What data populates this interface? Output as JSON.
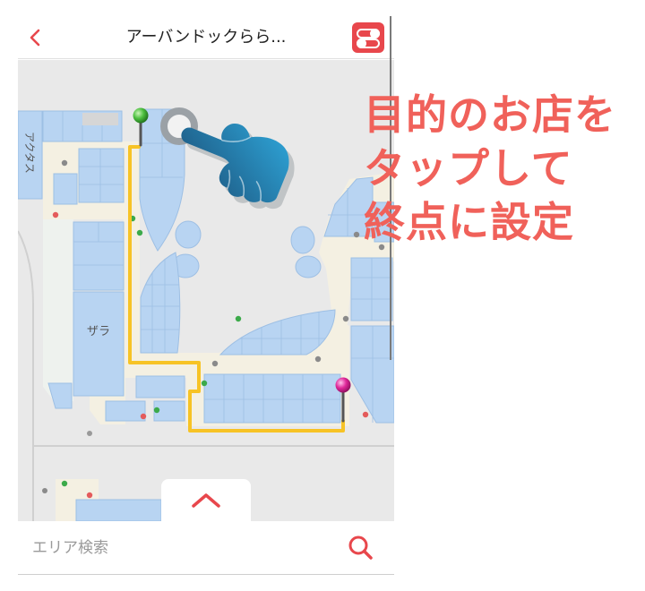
{
  "header": {
    "title": "アーバンドックらら...",
    "back_icon": "chevron-left-icon",
    "filter_icon": "toggle-switches-icon"
  },
  "map": {
    "shop_labels": {
      "actus": "アクタス",
      "zara": "ザラ"
    },
    "route_color": "#f7c325",
    "shop_color": "#b8d4f2",
    "corridor_color": "#f4f0e2",
    "start_pin": {
      "icon": "green-pin-icon",
      "color": "#4cbf3f"
    },
    "end_pin": {
      "icon": "magenta-pin-icon",
      "color": "#e0289a"
    },
    "tap_hint_icon": "hand-pointer-icon"
  },
  "callout": {
    "lines": [
      "目的のお店を",
      "タップして",
      "終点に設定"
    ],
    "color": "#f0615a"
  },
  "bottom_sheet": {
    "handle_icon": "chevron-up-icon"
  },
  "search": {
    "placeholder": "エリア検索",
    "icon": "search-icon"
  },
  "colors": {
    "accent": "#e8474c",
    "text": "#222222",
    "placeholder": "#9a9a9a"
  }
}
